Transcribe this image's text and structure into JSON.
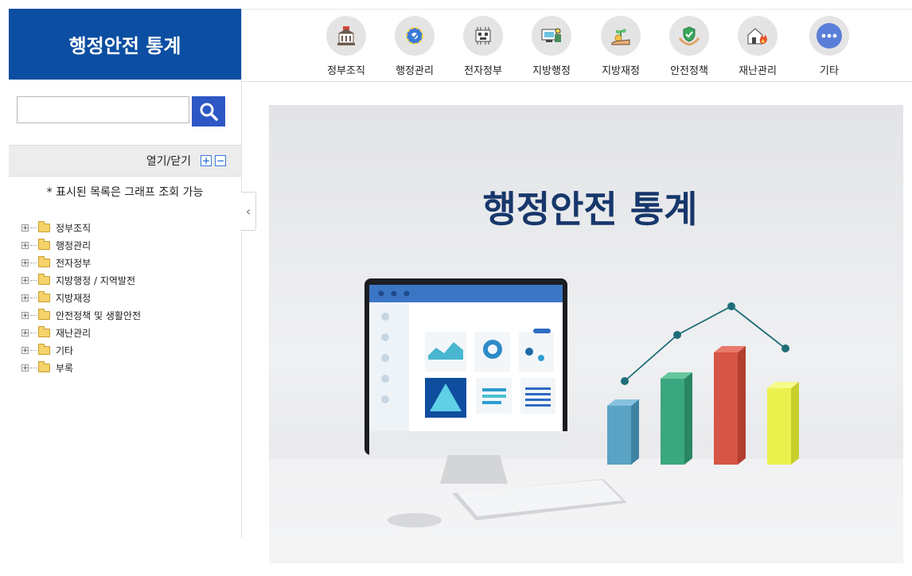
{
  "sidebar": {
    "title": "행정안전 통계",
    "search": {
      "value": "",
      "placeholder": ""
    },
    "toggle_label": "열기/닫기",
    "expand_symbol": "+",
    "collapse_symbol": "−",
    "hint": "* 표시된 목록은 그래프 조회 가능",
    "tree": [
      {
        "label": "정부조직"
      },
      {
        "label": "행정관리"
      },
      {
        "label": "전자정부"
      },
      {
        "label": "지방행정 / 지역발전"
      },
      {
        "label": "지방재정"
      },
      {
        "label": "안전정책 및 생활안전"
      },
      {
        "label": "재난관리"
      },
      {
        "label": "기타"
      },
      {
        "label": "부록"
      }
    ]
  },
  "collapse_handle": "‹",
  "topnav": [
    {
      "label": "정부조직",
      "icon": "government-building-icon"
    },
    {
      "label": "행정관리",
      "icon": "gear-icon"
    },
    {
      "label": "전자정부",
      "icon": "circuit-board-icon"
    },
    {
      "label": "지방행정",
      "icon": "monitor-admin-icon"
    },
    {
      "label": "지방재정",
      "icon": "money-sprout-icon"
    },
    {
      "label": "안전정책",
      "icon": "shield-hands-icon"
    },
    {
      "label": "재난관리",
      "icon": "house-fire-icon"
    },
    {
      "label": "기타",
      "icon": "more-dots-icon"
    }
  ],
  "hero": {
    "title": "행정안전 통계",
    "colors": {
      "bar1": "#5aa3c4",
      "bar2": "#3aa77f",
      "bar3": "#d65544",
      "bar4": "#eaf14d",
      "line": "#1e6d78"
    }
  }
}
